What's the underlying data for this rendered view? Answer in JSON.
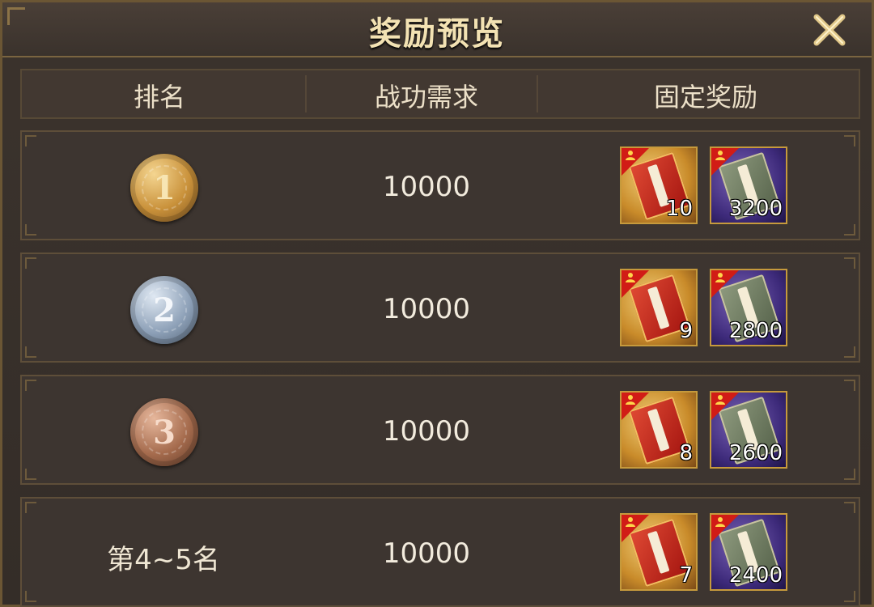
{
  "window": {
    "title": "奖励预览"
  },
  "header": {
    "rank": "排名",
    "requirement": "战功需求",
    "reward": "固定奖励"
  },
  "rows": [
    {
      "rank_badge": "1",
      "requirement": "10000",
      "rewards": [
        {
          "icon": "famous-general-card-icon",
          "count": "10"
        },
        {
          "icon": "military-book-icon",
          "count": "3200"
        }
      ]
    },
    {
      "rank_badge": "2",
      "requirement": "10000",
      "rewards": [
        {
          "icon": "famous-general-card-icon",
          "count": "9"
        },
        {
          "icon": "military-book-icon",
          "count": "2800"
        }
      ]
    },
    {
      "rank_badge": "3",
      "requirement": "10000",
      "rewards": [
        {
          "icon": "famous-general-card-icon",
          "count": "8"
        },
        {
          "icon": "military-book-icon",
          "count": "2600"
        }
      ]
    },
    {
      "rank_text": "第4~5名",
      "requirement": "10000",
      "rewards": [
        {
          "icon": "famous-general-card-icon",
          "count": "7"
        },
        {
          "icon": "military-book-icon",
          "count": "2400"
        }
      ]
    }
  ],
  "colors": {
    "gold": "#c9913a",
    "silver": "#8ea1b8",
    "bronze": "#a56b4d",
    "accent": "#c69a3c"
  }
}
